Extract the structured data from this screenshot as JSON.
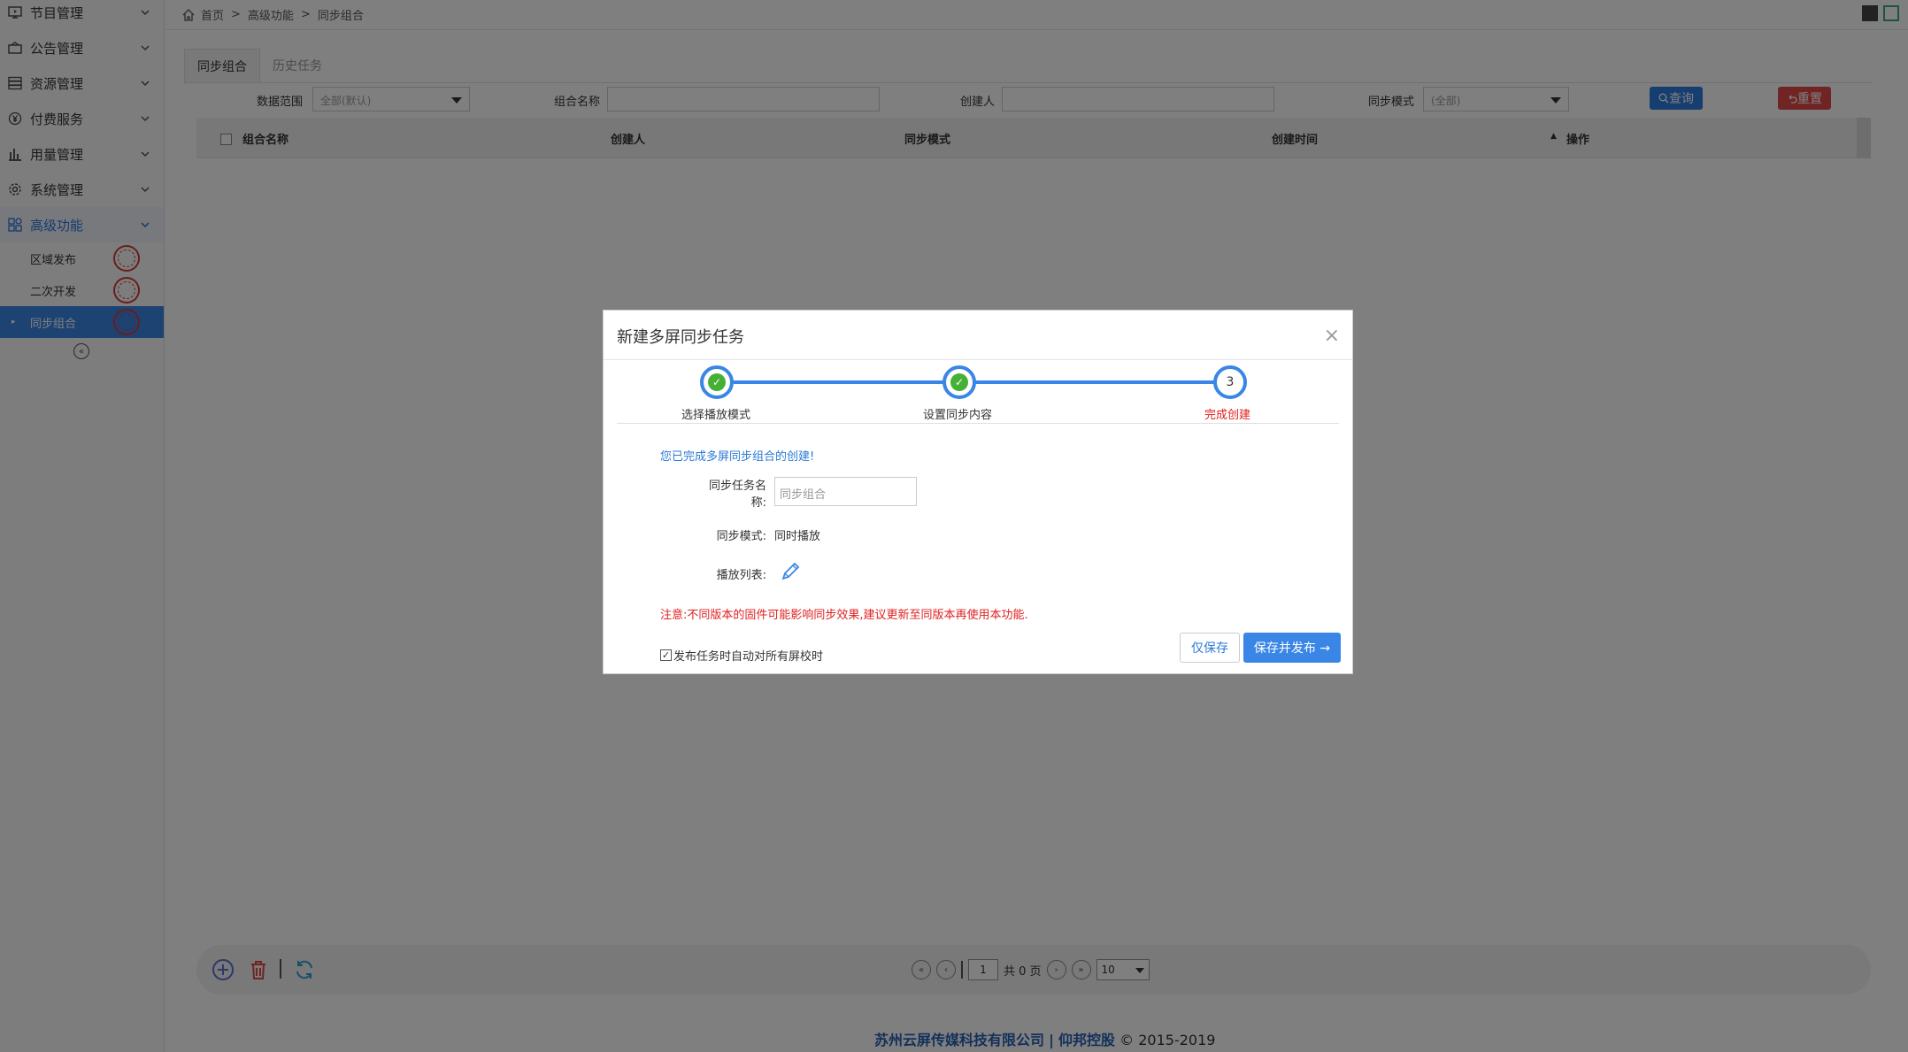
{
  "sidebar": {
    "items": [
      {
        "label": "节目管理",
        "icon": "monitor-icon"
      },
      {
        "label": "公告管理",
        "icon": "bulletin-icon"
      },
      {
        "label": "资源管理",
        "icon": "server-icon"
      },
      {
        "label": "付费服务",
        "icon": "yen-icon"
      },
      {
        "label": "用量管理",
        "icon": "bar-chart-icon"
      },
      {
        "label": "系统管理",
        "icon": "gear-icon"
      },
      {
        "label": "高级功能",
        "icon": "apps-icon"
      }
    ],
    "subitems": [
      {
        "label": "区域发布"
      },
      {
        "label": "二次开发"
      },
      {
        "label": "同步组合"
      }
    ]
  },
  "breadcrumb": {
    "home": "首页",
    "level1": "高级功能",
    "level2": "同步组合",
    "sep": ">"
  },
  "tabs": [
    {
      "label": "同步组合"
    },
    {
      "label": "历史任务"
    }
  ],
  "filters": {
    "scope_label": "数据范围",
    "scope_value": "全部(默认)",
    "group_name_label": "组合名称",
    "creator_label": "创建人",
    "mode_label": "同步模式",
    "mode_value": "(全部)",
    "query_label": "查询",
    "reset_label": "重置"
  },
  "table": {
    "columns": [
      "组合名称",
      "创建人",
      "同步模式",
      "创建时间",
      "操作"
    ]
  },
  "pager": {
    "page": "1",
    "total_text": "共 0 页",
    "page_size": "10"
  },
  "footer": {
    "company": "苏州云屏传媒科技有限公司",
    "divider": "|",
    "brand": "仰邦控股",
    "copyright": "© 2015-2019"
  },
  "modal": {
    "title": "新建多屏同步任务",
    "close": "×",
    "steps": [
      {
        "label": "选择播放模式",
        "status": "done"
      },
      {
        "label": "设置同步内容",
        "status": "done"
      },
      {
        "label": "完成创建",
        "status": "current",
        "number": "3"
      }
    ],
    "success_message": "您已完成多屏同步组合的创建!",
    "name_label_line1": "同步任务名",
    "name_label_line2": "称:",
    "name_placeholder": "同步组合",
    "mode_label": "同步模式:",
    "mode_value": "同时播放",
    "playlist_label": "播放列表:",
    "notice": "注意:不同版本的固件可能影响同步效果,建议更新至同版本再使用本功能.",
    "calibrate_label": "发布任务时自动对所有屏校时",
    "calibrate_checked": true,
    "save_only_label": "仅保存",
    "save_publish_label": "保存并发布 →"
  },
  "colors": {
    "accent": "#3a86e6",
    "success": "#45b035",
    "danger": "#e02020",
    "reset": "#e34848"
  }
}
